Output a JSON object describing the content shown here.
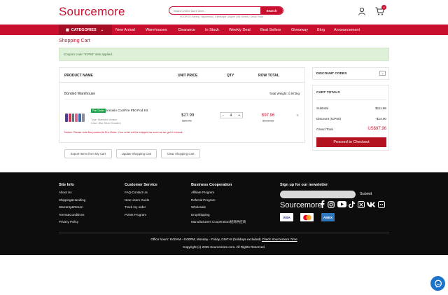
{
  "header": {
    "logo_a": "Source",
    "logo_b": "more",
    "search_placeholder": "Search entire store here...",
    "search_button": "Search",
    "hot_searches": "VOOPOO Series | Vaporesso | Geekvape | Aspire | Kit Series | Smok Pods",
    "cart_count": "0"
  },
  "nav": {
    "categories": "CATEGORIES",
    "items": [
      "New Arrival",
      "Warehouses",
      "Clearance",
      "In Stock",
      "Weekly Deal",
      "Best Sellers",
      "Giveaway",
      "Blog",
      "Announcement"
    ]
  },
  "page": {
    "title": "Shopping Cart",
    "coupon_msg": "Coupon code \"ICP60\" was applied."
  },
  "cart": {
    "headers": [
      "PRODUCT NAME",
      "UNIT PRICE",
      "QTY",
      "ROW TOTAL"
    ],
    "warehouse": "Bonded Warehouse",
    "weight": "Total Weight: 0.972kg",
    "item": {
      "badge": "Pre-Order",
      "name": "Innokin CoolFire Pb0 Pod Kit",
      "type": "Type:  Standard Version",
      "color": "Color:  Blue Silver Gradient",
      "unit_price": "$27.99",
      "unit_old": "$29.79",
      "qty": "4",
      "row_total": "$97.96",
      "row_old": "$143.16"
    },
    "notice": "Notice: Please note the product is Pre-Order. Your order will be shipped as soon as we get it in stock.",
    "buttons": [
      "Export Items from My Cart",
      "Update Shopping Cart",
      "Clear Shopping Cart"
    ]
  },
  "summary": {
    "discount_codes": "DISCOUNT CODES",
    "cart_totals": "CART TOTALS",
    "subtotal_label": "Subtotal",
    "subtotal": "$111.96",
    "discount_label": "Discount (ICP60)",
    "discount": "-$14.00",
    "grand_label": "Grand Total",
    "grand": "US$97.96",
    "checkout": "Proceed to Checkout"
  },
  "footer": {
    "col1_title": "Site Info",
    "col1": [
      "About Us",
      "Shipping&Handling",
      "Warranty&Return",
      "Terms&Conditions",
      "Privacy Policy"
    ],
    "col2_title": "Customer Service",
    "col2": [
      "FAQ-Contact Us",
      "New Users Guide",
      "Track my order",
      "Points Program"
    ],
    "col3_title": "Business Cooperation",
    "col3": [
      "Affiliate Program",
      "Referral Program",
      "Wholesale",
      "Dropshipping",
      "Manufacturers Cooperation/招商供应商"
    ],
    "newsletter_title": "Sign up for our newsletter",
    "submit": "Submit",
    "logo": "Sourcemore",
    "payments": [
      "VISA",
      "MC",
      "AMEX"
    ],
    "hours": "Office hours: 9:00AM - 6:00PM, Monday - Friday, GMT+8 (holidays excluded)",
    "hours_link": "Check Sourcemore Time",
    "copyright": "Copyright (c) 2025 Sourcemore.com. All Rights Reserved."
  },
  "colors": {
    "brand_red": "#c8102e",
    "footer_bg": "#0d0d0d",
    "success_bg": "#dff0d8"
  }
}
